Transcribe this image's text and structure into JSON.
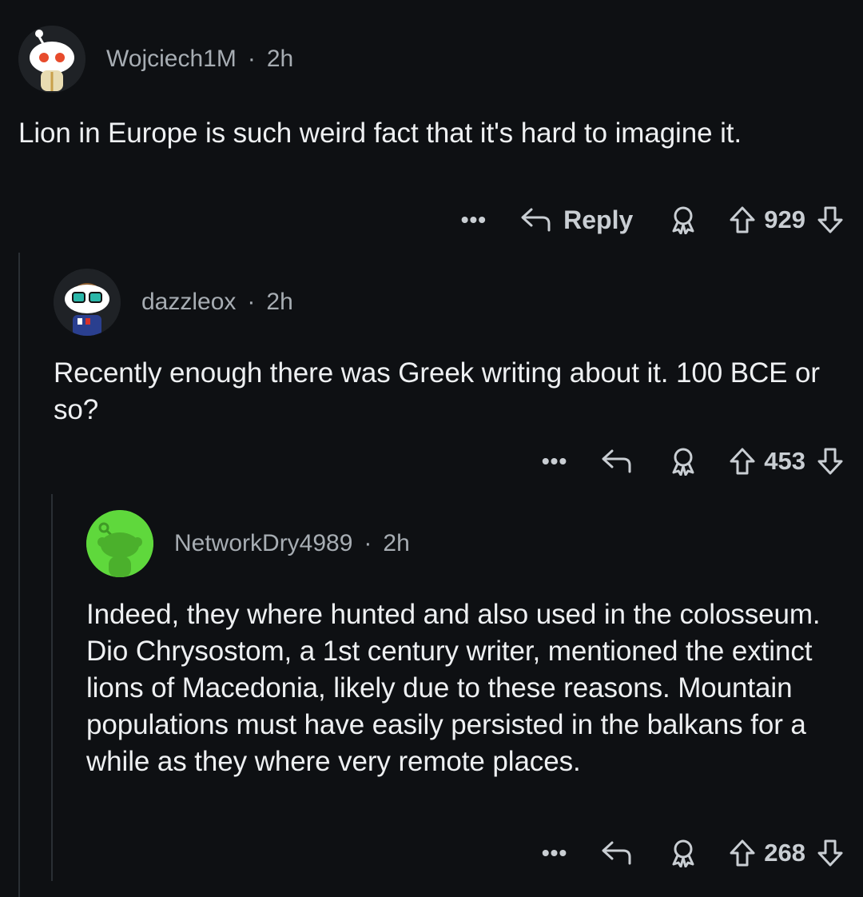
{
  "comments": [
    {
      "username": "Wojciech1M",
      "separator": "·",
      "time": "2h",
      "text": "Lion in Europe is such weird fact that it's hard to imagine it.",
      "actions": {
        "more": "•••",
        "reply_label": "Reply",
        "score": "929"
      },
      "avatar": {
        "bg": "#ffffff",
        "accent": "#e74b2c"
      }
    },
    {
      "username": "dazzleox",
      "separator": "·",
      "time": "2h",
      "text": "Recently enough there was Greek writing about it. 100 BCE or so?",
      "actions": {
        "more": "•••",
        "score": "453"
      },
      "avatar": {
        "bg": "#ffffff",
        "accent": "#2ab6a8"
      }
    },
    {
      "username": "NetworkDry4989",
      "separator": "·",
      "time": "2h",
      "text": "Indeed, they where hunted and also used in the colosseum. Dio Chrysostom, a 1st century writer, mentioned the extinct lions of Macedonia, likely due to these reasons. Mountain populations must have easily persisted in the balkans for a while as they where very remote places.",
      "actions": {
        "more": "•••",
        "score": "268"
      },
      "avatar": {
        "bg": "#5fd83c",
        "accent": "#4bb02c"
      }
    }
  ],
  "colors": {
    "background": "#0e1013",
    "text": "#eef0f2",
    "meta": "#a7adb3",
    "icon": "#c9ced3",
    "thread_line": "#2a2f34"
  }
}
